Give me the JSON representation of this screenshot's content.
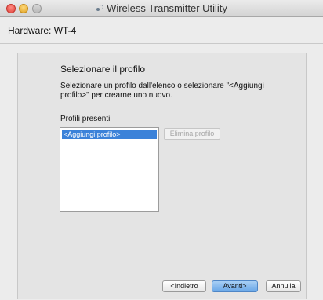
{
  "window": {
    "title": "Wireless Transmitter Utility",
    "app_icon": "wireless-signal-icon"
  },
  "hardware": {
    "label": "Hardware: WT-4"
  },
  "content": {
    "heading": "Selezionare il profilo",
    "description": "Selezionare un profilo dall'elenco o selezionare \"<Aggiungi profilo>\" per crearne uno nuovo.",
    "profiles_label": "Profili presenti",
    "profiles": [
      {
        "label": "<Aggiungi profilo>",
        "selected": true
      }
    ],
    "delete_label": "Elimina profilo"
  },
  "footer": {
    "back_label": "<Indietro",
    "next_label": "Avanti>",
    "cancel_label": "Annulla"
  },
  "colors": {
    "accent": "#3b82d9",
    "default_button": "#6aa7e8"
  }
}
